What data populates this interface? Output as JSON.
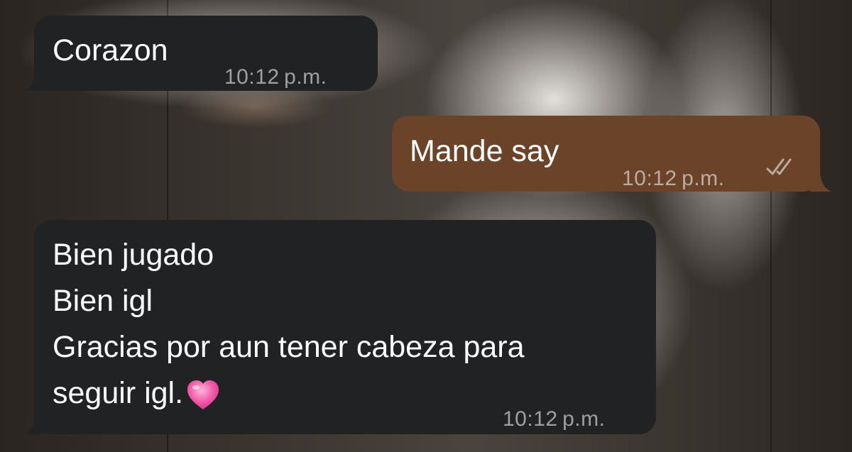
{
  "messages": [
    {
      "direction": "incoming",
      "lines": [
        "Corazon"
      ],
      "time": "10:12 p.m."
    },
    {
      "direction": "outgoing",
      "lines": [
        "Mande say"
      ],
      "time": "10:12 p.m.",
      "status_icon": "double-check-icon"
    },
    {
      "direction": "incoming",
      "lines": [
        "Bien jugado",
        "Bien igl",
        "Gracias por aun tener cabeza para",
        "seguir igl."
      ],
      "emoji": "pink-heart-icon",
      "time": "10:12 p.m."
    }
  ],
  "colors": {
    "incoming_bubble": "#202223",
    "outgoing_bubble": "#6b4329",
    "text": "#ffffff",
    "timestamp": "#b5b5b5"
  }
}
